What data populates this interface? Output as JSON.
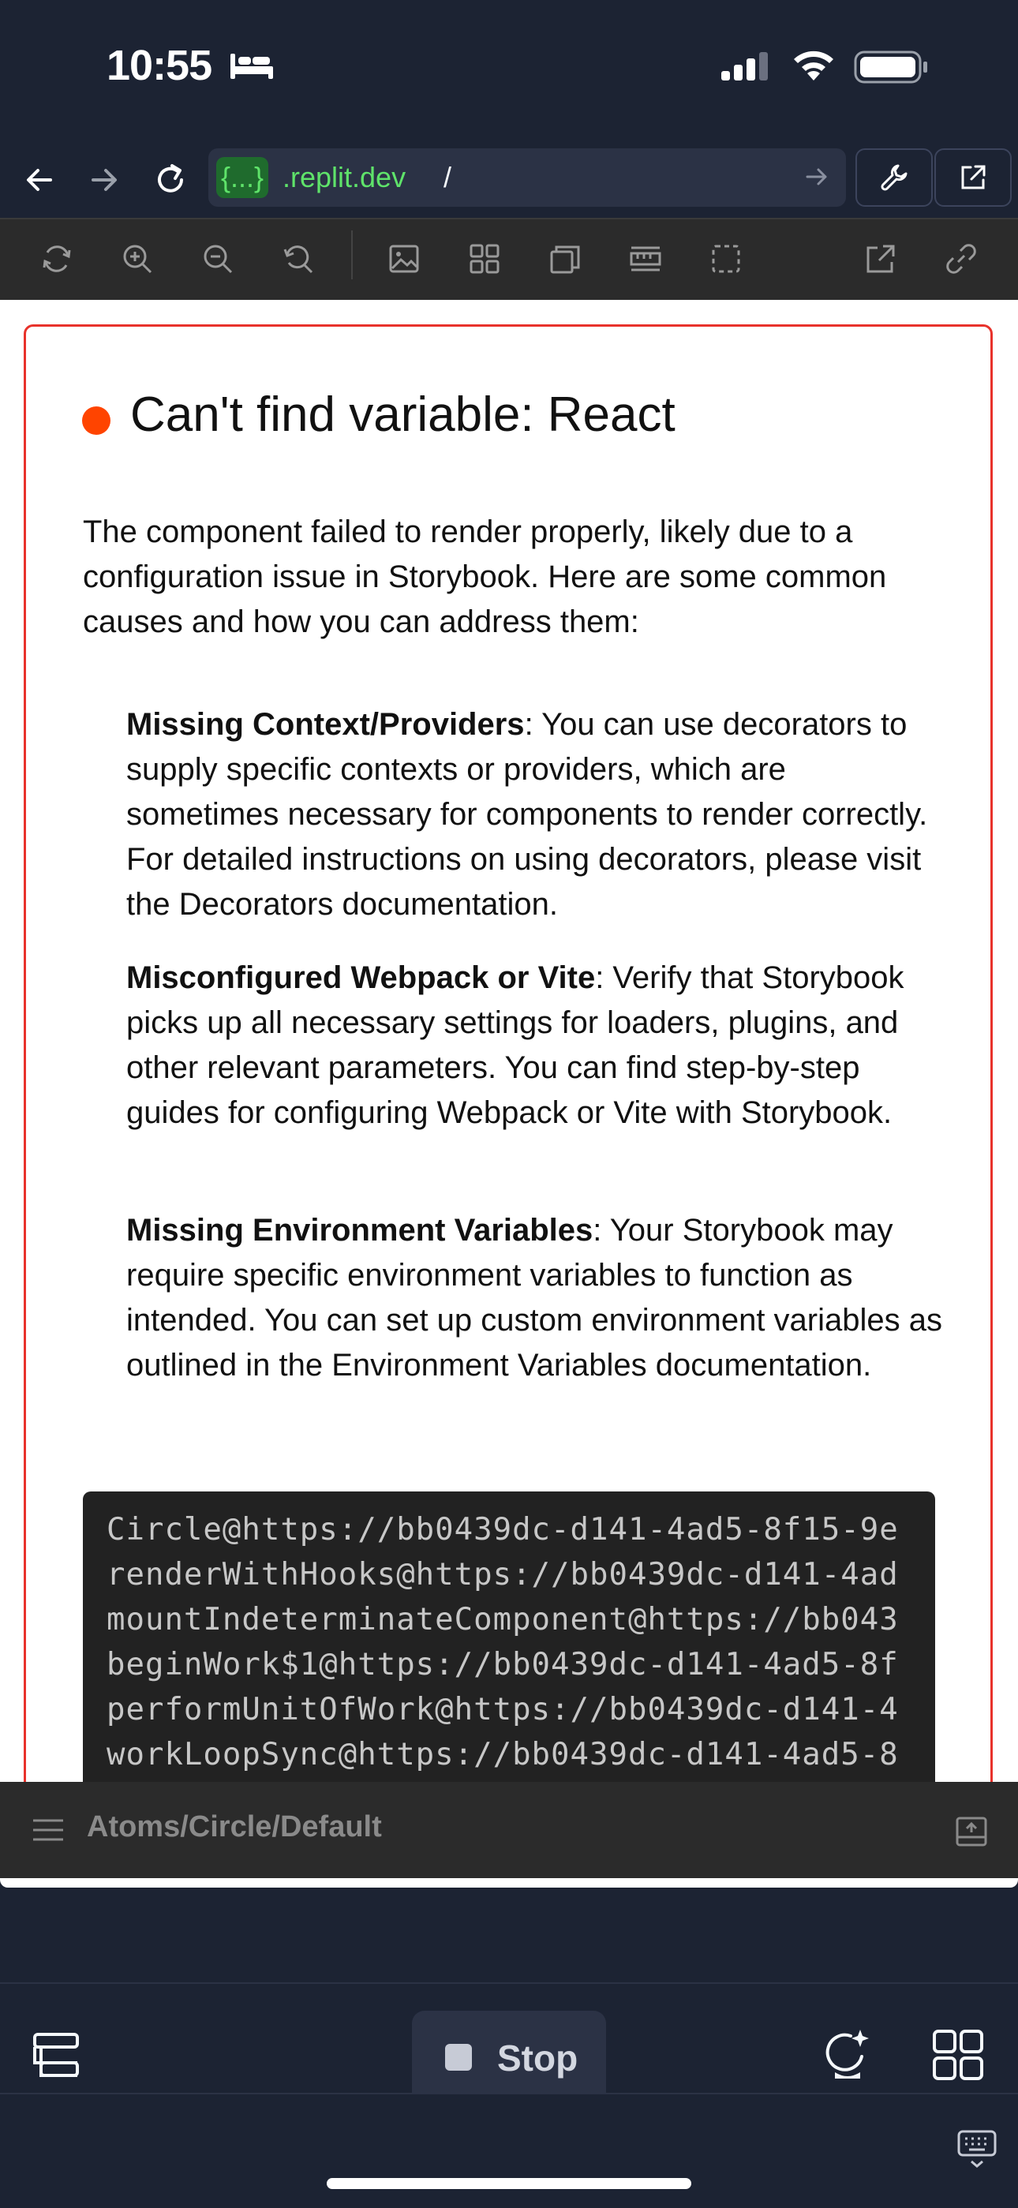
{
  "status_bar": {
    "time": "10:55",
    "icons": [
      "bed-icon",
      "cellular-signal-icon",
      "wifi-icon",
      "battery-icon"
    ]
  },
  "browser": {
    "url_host_tag": "{...}",
    "url_domain": ".replit.dev",
    "url_path": "/",
    "nav_icons": [
      "back-arrow-icon",
      "forward-arrow-icon",
      "reload-icon",
      "go-arrow-icon",
      "wrench-icon",
      "open-external-icon"
    ]
  },
  "storybook_toolbar": {
    "icons": [
      "remount-icon",
      "zoom-in-icon",
      "zoom-out-icon",
      "zoom-reset-icon",
      "background-image-icon",
      "grid-icon",
      "viewport-icon",
      "measure-ruler-icon",
      "outline-icon",
      "open-new-tab-icon",
      "copy-link-icon"
    ]
  },
  "error": {
    "title": "Can't find variable: React",
    "intro": "The component failed to render properly, likely due to a configuration issue in Storybook. Here are some common causes and how you can address them:",
    "items": [
      {
        "heading": "Missing Context/Providers",
        "text": ": You can use decorators to supply specific contexts or providers, which are sometimes necessary for components to render correctly. For detailed instructions on using decorators, please visit the Decorators documentation."
      },
      {
        "heading": "Misconfigured Webpack or Vite",
        "text": ": Verify that Storybook picks up all necessary settings for loaders, plugins, and other relevant parameters. You can find step-by-step guides for configuring Webpack or Vite with Storybook."
      },
      {
        "heading": "Missing Environment Variables",
        "text": ": Your Storybook may require specific environment variables to function as intended. You can set up custom environment variables as outlined in the Environment Variables documentation."
      }
    ],
    "stack": [
      "Circle@https://bb0439dc-d141-4ad5-8f15-9e",
      "renderWithHooks@https://bb0439dc-d141-4ad",
      "mountIndeterminateComponent@https://bb043",
      "beginWork$1@https://bb0439dc-d141-4ad5-8f",
      "performUnitOfWork@https://bb0439dc-d141-4",
      "workLoopSync@https://bb0439dc-d141-4ad5-8"
    ]
  },
  "storybook_bottom": {
    "story_path": "Atoms/Circle/Default"
  },
  "app_nav": {
    "stop_label": "Stop"
  },
  "colors": {
    "app_bg": "#1c2333",
    "error_border": "#e8322b",
    "error_dot": "#ff4400",
    "url_green": "#5fe36a",
    "code_bg": "#222222"
  }
}
